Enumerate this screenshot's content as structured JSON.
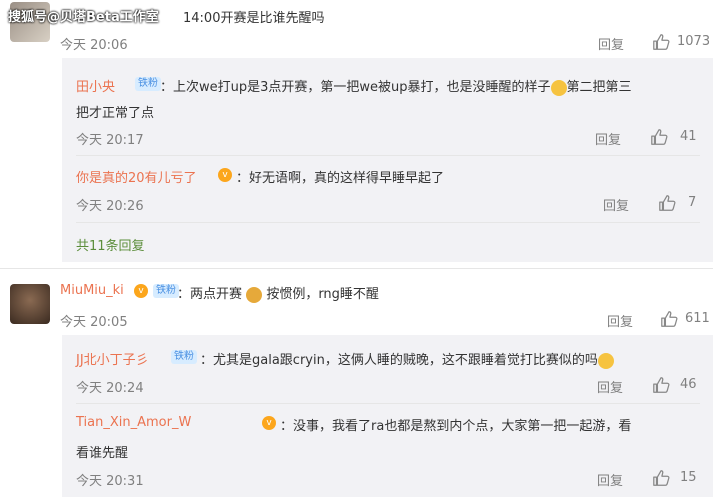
{
  "watermark": "搜狐号@贝塔Beta工作室",
  "top_comment": {
    "text_tail": "14:00开赛是比谁先醒吗",
    "time": "今天 20:06",
    "reply_label": "回复",
    "likes": "1073"
  },
  "reply1": {
    "name": "田小央",
    "badge": "铁粉",
    "text": "上次we打up是3点开赛，第一把we被up暴打，也是没睡醒的样子",
    "text2_tail": "第二把第三",
    "text_line2": "把才正常了点",
    "time": "今天 20:17",
    "reply_label": "回复",
    "likes": "41"
  },
  "reply2": {
    "name": "你是真的20有儿亏了",
    "text": "好无语啊，真的这样得早睡早起了",
    "time": "今天 20:26",
    "reply_label": "回复",
    "likes": "7"
  },
  "more_replies": "共11条回复",
  "comment2": {
    "name": "MiuMiu_ki",
    "badge": "铁粉",
    "text_a": "两点开赛",
    "text_b": "按惯例，rng睡不醒",
    "time": "今天 20:05",
    "reply_label": "回复",
    "likes": "611"
  },
  "reply3": {
    "name": "JJ北小丁子彡",
    "badge": "铁粉",
    "text": "尤其是gala跟cryin，这俩人睡的贼晚，这不跟睡着觉打比赛似的吗",
    "time": "今天 20:24",
    "reply_label": "回复",
    "likes": "46"
  },
  "reply4": {
    "name": "Tian_Xin_Amor_W",
    "text": "没事，我看了ra也都是熬到内个点，大家第一把一起游，看",
    "text_line2": "看谁先醒",
    "time": "今天 20:31",
    "reply_label": "回复",
    "likes": "15"
  },
  "colors": {
    "name": "#eb7350",
    "meta": "#808080",
    "reply_bg": "#f2f2f5",
    "more": "#5b8d3a"
  }
}
